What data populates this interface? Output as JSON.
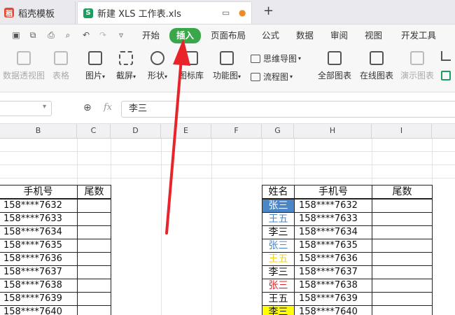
{
  "tabs": {
    "templates": "稻壳模板",
    "workbook": "新建 XLS 工作表.xls",
    "add": "+"
  },
  "menu": [
    "开始",
    "插入",
    "页面布局",
    "公式",
    "数据",
    "审阅",
    "视图",
    "开发工具"
  ],
  "ribbon": {
    "pivot": "数据透视图",
    "table": "表格",
    "picture": "图片",
    "screenshot": "截屏",
    "shapes": "形状",
    "iconlib": "图标库",
    "funcchart": "功能图",
    "mindmap": "思维导图",
    "flowchart": "流程图",
    "allcharts": "全部图表",
    "onlinecharts": "在线图表",
    "demochart": "演示图表"
  },
  "formula": {
    "fx": "fx",
    "value": "李三"
  },
  "columns": [
    "B",
    "C",
    "D",
    "E",
    "F",
    "G",
    "H",
    "I"
  ],
  "left_table": {
    "headers": [
      "手机号",
      "尾数"
    ],
    "phones": [
      "158****7632",
      "158****7633",
      "158****7634",
      "158****7635",
      "158****7636",
      "158****7637",
      "158****7638",
      "158****7639",
      "158****7640"
    ]
  },
  "right_table": {
    "headers": [
      "姓名",
      "手机号",
      "尾数"
    ],
    "rows": [
      {
        "name": "张三",
        "phone": "158****7632",
        "color": "#ffffff",
        "bg": "#4a86c8"
      },
      {
        "name": "王五",
        "phone": "158****7633",
        "color": "#4a86c8",
        "bg": "#ffffff"
      },
      {
        "name": "李三",
        "phone": "158****7634",
        "color": "#111111",
        "bg": "#ffffff"
      },
      {
        "name": "张三",
        "phone": "158****7635",
        "color": "#4a86c8",
        "bg": "#ffffff"
      },
      {
        "name": "王五",
        "phone": "158****7636",
        "color": "#f2d21c",
        "bg": "#ffffff"
      },
      {
        "name": "李三",
        "phone": "158****7637",
        "color": "#111111",
        "bg": "#ffffff"
      },
      {
        "name": "张三",
        "phone": "158****7638",
        "color": "#e02020",
        "bg": "#ffffff"
      },
      {
        "name": "王五",
        "phone": "158****7639",
        "color": "#111111",
        "bg": "#ffffff"
      },
      {
        "name": "李三",
        "phone": "158****7640",
        "color": "#111111",
        "bg": "#ffff00"
      }
    ]
  },
  "colors": {
    "accent": "#3aa84a",
    "arrow": "#e8232a"
  }
}
